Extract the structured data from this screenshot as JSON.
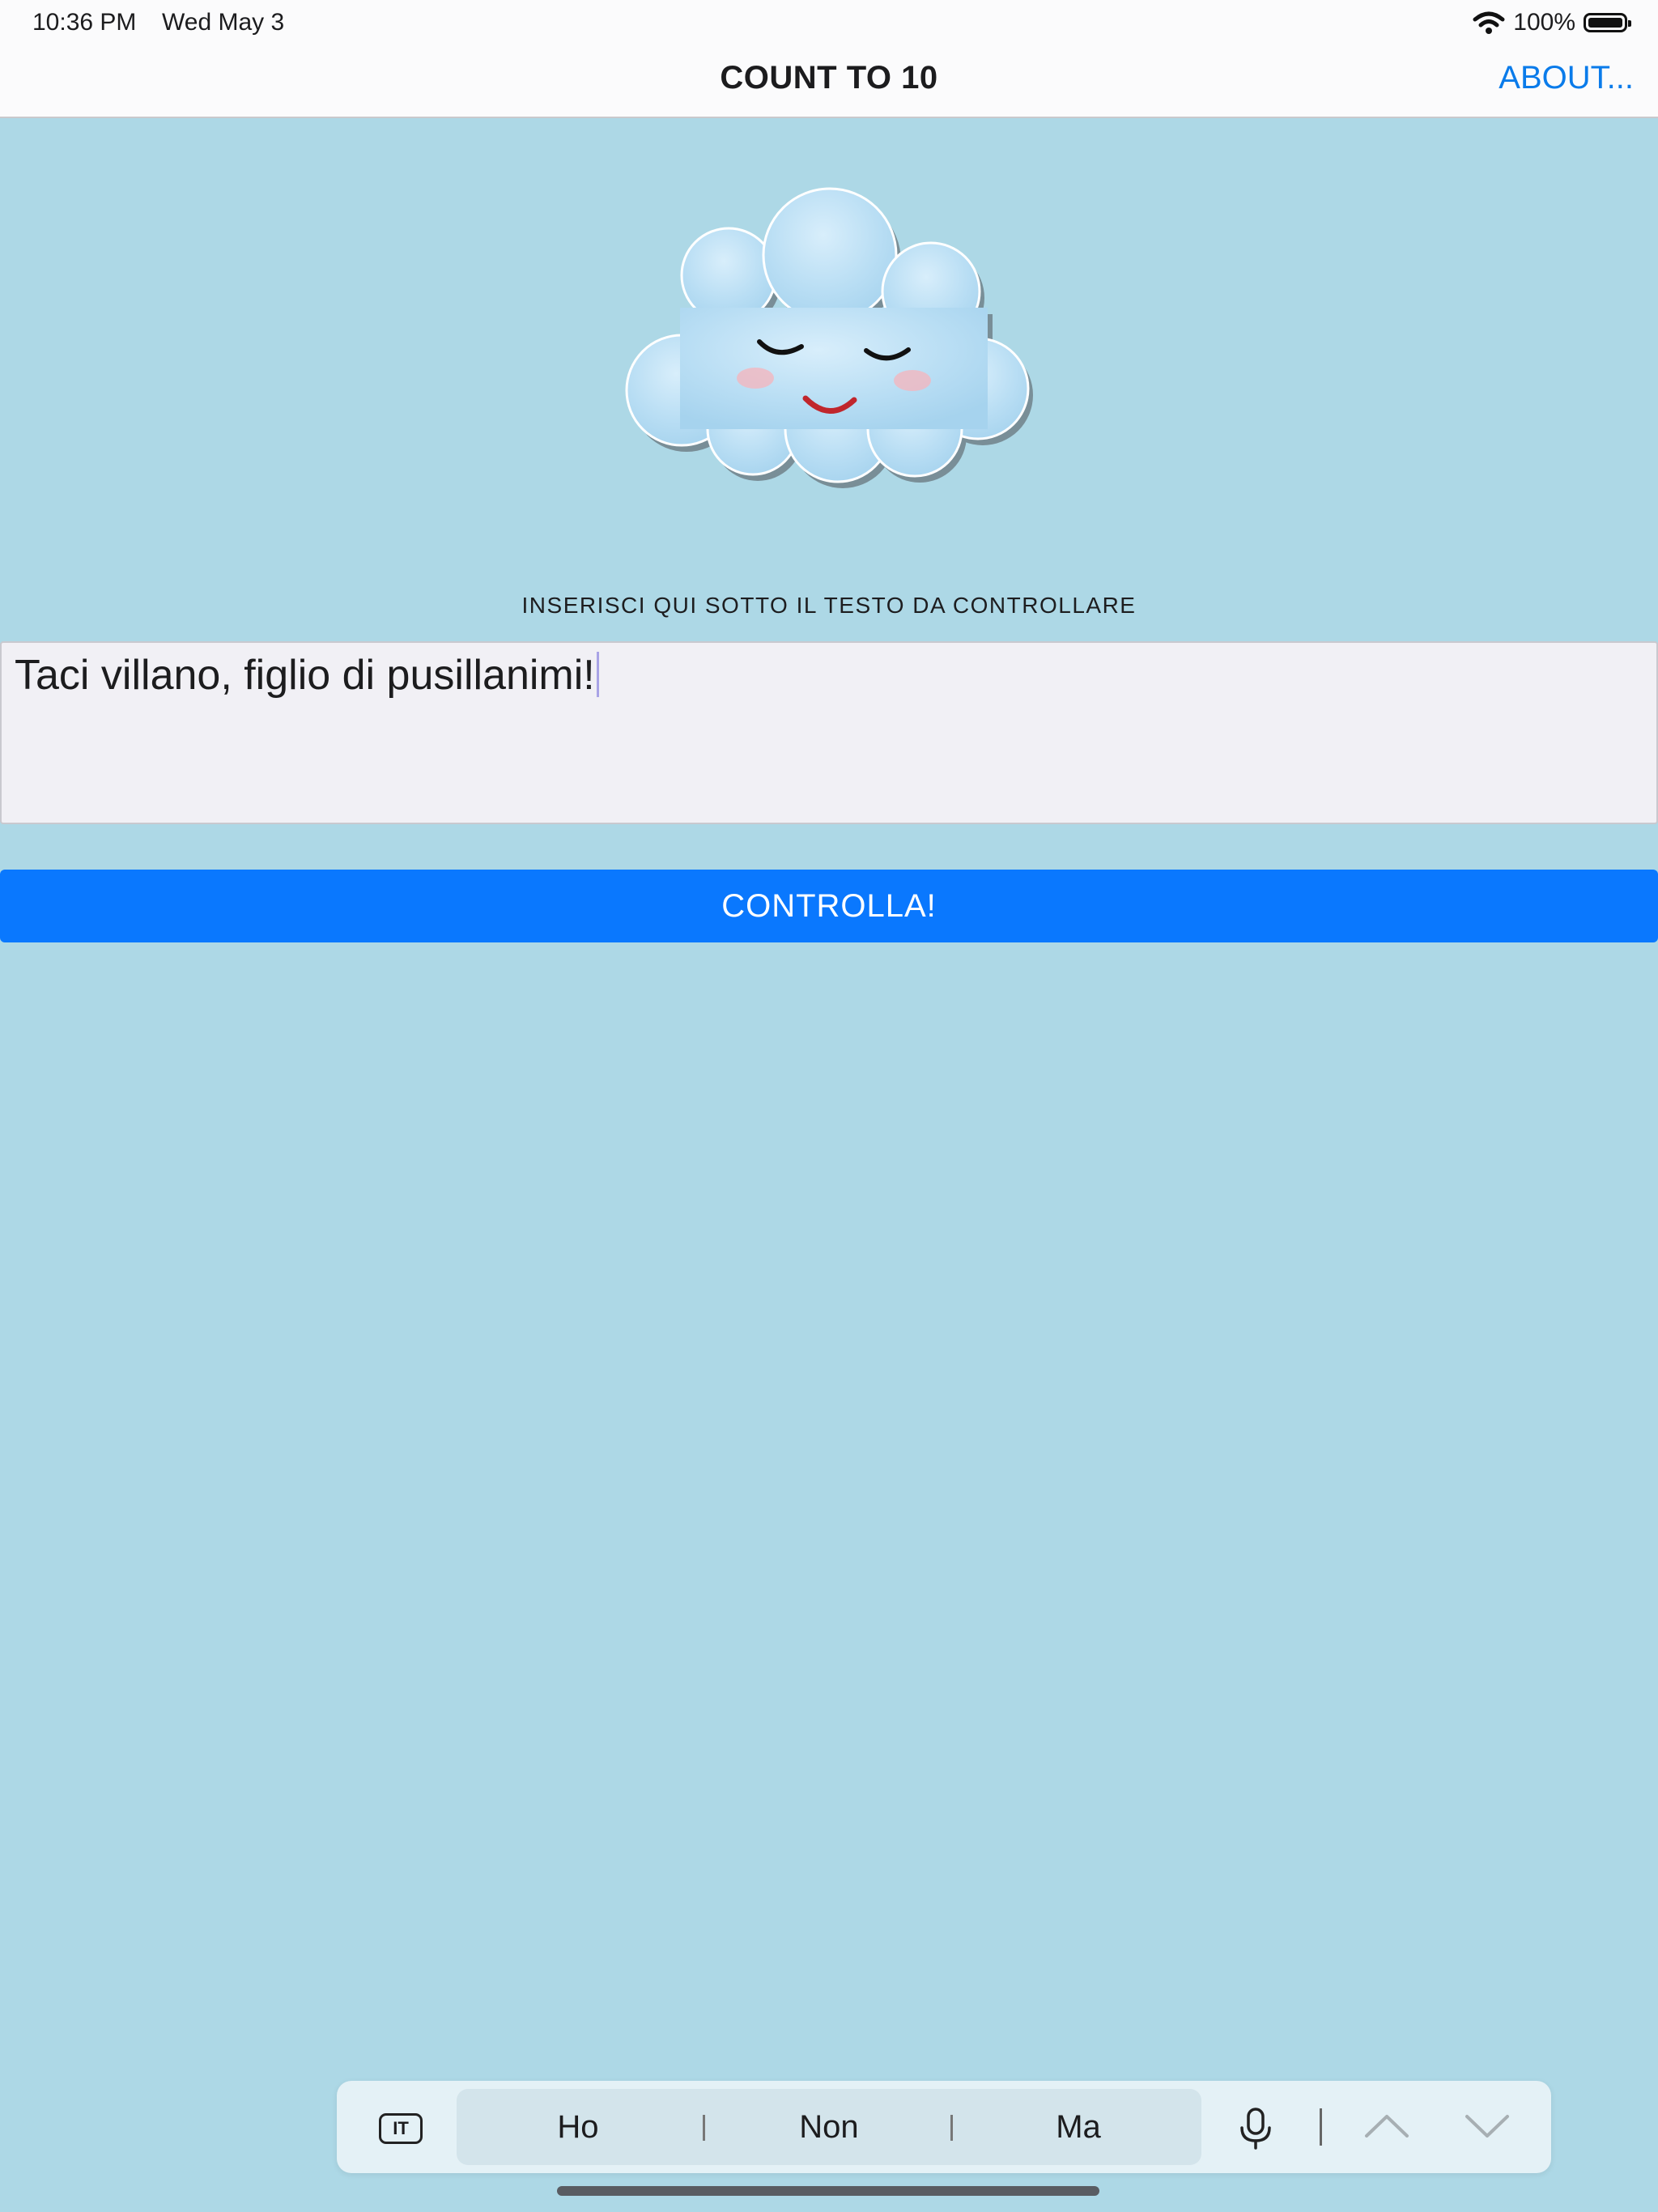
{
  "status_bar": {
    "time": "10:36 PM",
    "date": "Wed May 3",
    "battery": "100%"
  },
  "nav": {
    "title": "COUNT TO 10",
    "about": "ABOUT..."
  },
  "main": {
    "prompt": "INSERISCI QUI SOTTO IL TESTO DA CONTROLLARE",
    "input_value": "Taci villano, figlio di pusillanimi!",
    "button_label": "CONTROLLA!"
  },
  "keyboard_bar": {
    "language": "IT",
    "suggestions": [
      "Ho",
      "Non",
      "Ma"
    ],
    "icons": [
      "microphone-icon",
      "chevron-up-icon",
      "chevron-down-icon"
    ]
  },
  "colors": {
    "background": "#add8e6",
    "accent": "#0a78fe",
    "link": "#0a7bea"
  }
}
